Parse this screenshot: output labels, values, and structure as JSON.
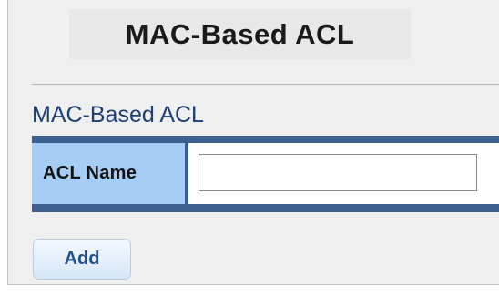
{
  "header": {
    "title": "MAC-Based ACL"
  },
  "section": {
    "title": "MAC-Based ACL"
  },
  "form": {
    "acl_name_label": "ACL Name",
    "acl_name_value": "",
    "acl_name_placeholder": ""
  },
  "actions": {
    "add_label": "Add"
  },
  "colors": {
    "section_title": "#1f3f73",
    "table_border": "#3c5f90",
    "label_cell": "#a5cdf5",
    "button_text": "#1f4f8c"
  }
}
